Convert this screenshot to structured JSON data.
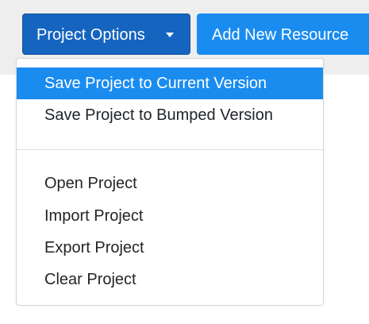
{
  "toolbar": {
    "project_options_label": "Project Options",
    "add_resource_label": "Add New Resource"
  },
  "menu": {
    "save_current": "Save Project to Current Version",
    "save_bumped": "Save Project to Bumped Version",
    "open": "Open Project",
    "import": "Import Project",
    "export": "Export Project",
    "clear": "Clear Project"
  },
  "colors": {
    "primary_dark": "#1565c0",
    "primary": "#1a8cf0",
    "menu_text": "#212529",
    "toolbar_background": "#eeeeee"
  },
  "icons": {
    "dropdown_caret": "caret-down-icon"
  }
}
